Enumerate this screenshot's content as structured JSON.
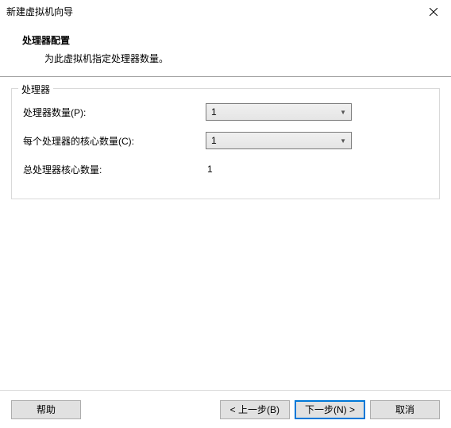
{
  "window": {
    "title": "新建虚拟机向导"
  },
  "header": {
    "title": "处理器配置",
    "subtitle": "为此虚拟机指定处理器数量。"
  },
  "group": {
    "label": "处理器",
    "rows": {
      "proc_count_label": "处理器数量(P):",
      "proc_count_value": "1",
      "cores_label": "每个处理器的核心数量(C):",
      "cores_value": "1",
      "total_label": "总处理器核心数量:",
      "total_value": "1"
    }
  },
  "footer": {
    "help": "帮助",
    "back": "< 上一步(B)",
    "next": "下一步(N) >",
    "cancel": "取消"
  }
}
